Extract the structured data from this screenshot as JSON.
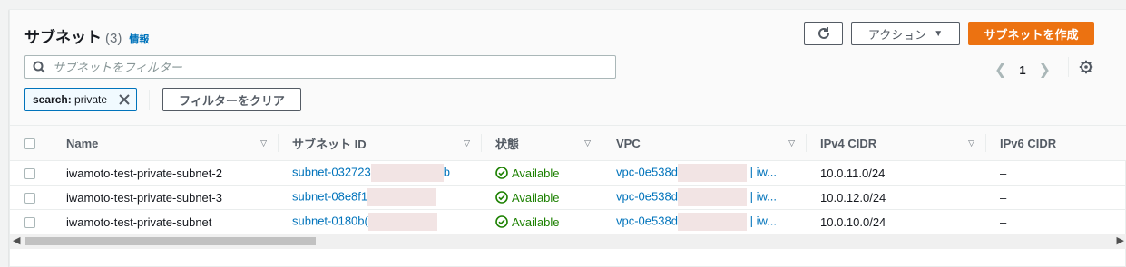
{
  "header": {
    "title": "サブネット",
    "count": "(3)",
    "info_link": "情報",
    "actions_label": "アクション",
    "create_label": "サブネットを作成"
  },
  "search": {
    "placeholder": "サブネットをフィルター"
  },
  "pagination": {
    "current_page": "1"
  },
  "filter": {
    "token_key": "search:",
    "token_value": "private",
    "clear_label": "フィルターをクリア"
  },
  "table": {
    "columns": [
      "Name",
      "サブネット ID",
      "状態",
      "VPC",
      "IPv4 CIDR",
      "IPv6 CIDR"
    ],
    "rows": [
      {
        "name": "iwamoto-test-private-subnet-2",
        "subnet_id": "subnet-032723",
        "subnet_id_tail": "b",
        "state": "Available",
        "vpc": "vpc-0e538d",
        "vpc_tail": "| iw...",
        "ipv4": "10.0.11.0/24",
        "ipv6": "–"
      },
      {
        "name": "iwamoto-test-private-subnet-3",
        "subnet_id": "subnet-08e8f1",
        "subnet_id_tail": "",
        "state": "Available",
        "vpc": "vpc-0e538d",
        "vpc_tail": "| iw...",
        "ipv4": "10.0.12.0/24",
        "ipv6": "–"
      },
      {
        "name": "iwamoto-test-private-subnet",
        "subnet_id": "subnet-0180b(",
        "subnet_id_tail": "",
        "state": "Available",
        "vpc": "vpc-0e538d",
        "vpc_tail": "| iw...",
        "ipv4": "10.0.10.0/24",
        "ipv6": "–"
      }
    ]
  },
  "colors": {
    "accent": "#0073bb",
    "primary_button": "#ec7211",
    "available": "#1d8102",
    "redaction": "#f2e4e4"
  }
}
